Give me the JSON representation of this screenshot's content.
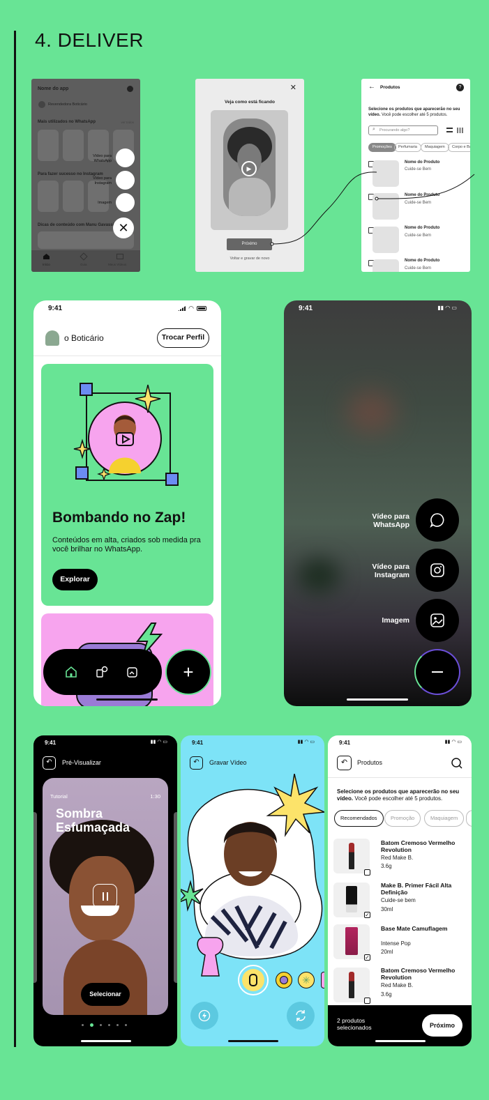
{
  "section": {
    "title": "4. DELIVER"
  },
  "wf1": {
    "title": "Nome do app",
    "reseller": "Revendedora Boticário",
    "most_used": "Mais utilizados no WhatsApp",
    "see_all": "ver todos",
    "success": "Para fazer sucesso no Instagram",
    "tips": "Dicas de conteúdo com Manu Gavassi",
    "fab_labels": [
      "Vídeo para WhatsApp",
      "Vídeo para Instagram",
      "Imagem"
    ],
    "nav": [
      "Início",
      "Guia",
      "Meus Vídeos"
    ]
  },
  "wf2": {
    "heading": "Veja como está ficando",
    "next": "Próximo",
    "redo": "Voltar e gravar de novo"
  },
  "wf3": {
    "title": "Produtos",
    "instruction_bold": "Selecione os produtos que aparecerão no seu vídeo.",
    "instruction_rest": " Você pode escolher até 5 produtos.",
    "search_placeholder": "Procurando algo?",
    "chips": [
      "Promoções",
      "Perfumaria",
      "Maquiagem",
      "Corpo e Ban"
    ],
    "products": [
      {
        "name": "Nome do Produto",
        "brand": "Cuide-se Bem"
      },
      {
        "name": "Nome do Produto",
        "brand": "Cuide-se Bem"
      },
      {
        "name": "Nome do Produto",
        "brand": "Cuide-se Bem"
      },
      {
        "name": "Nome do Produto",
        "brand": "Cuide-se Bem"
      }
    ]
  },
  "phone_home": {
    "time": "9:41",
    "brand": "o Boticário",
    "switch_profile": "Trocar Perfil",
    "card_title": "Bombando no Zap!",
    "card_text": "Conteúdos em alta, criados sob medida pra você brilhar no WhatsApp.",
    "explore": "Explorar"
  },
  "phone_menu": {
    "time": "9:41",
    "options": [
      "Vídeo para WhatsApp",
      "Vídeo para Instagram",
      "Imagem"
    ]
  },
  "phone_preview": {
    "time": "9:41",
    "title": "Pré-Visualizar",
    "tag": "Tutorial",
    "duration": "1:30",
    "video_title": "Sombra Esfumaçada",
    "select": "Selecionar"
  },
  "phone_record": {
    "time": "9:41",
    "title": "Gravar Vídeo"
  },
  "phone_products": {
    "time": "9:41",
    "title": "Produtos",
    "instruction_bold": "Selecione os produtos que aparecerão no seu vídeo.",
    "instruction_rest": " Você pode escolher até 5 produtos.",
    "chips": [
      "Recomendados",
      "Promoção",
      "Maquiagem"
    ],
    "products": [
      {
        "name": "Batom Cremoso Vermelho Revolution",
        "brand": "Red Make B.",
        "size": "3.6g",
        "checked": false
      },
      {
        "name": "Make B. Primer Fácil Alta Definição",
        "brand": "Cuide-se bem",
        "size": "30ml",
        "checked": true
      },
      {
        "name": "Base Mate Camuflagem",
        "brand": "Intense Pop",
        "size": "20ml",
        "checked": true
      },
      {
        "name": "Batom Cremoso Vermelho Revolution",
        "brand": "Red Make B.",
        "size": "3.6g",
        "checked": false
      }
    ],
    "selected_count": "2 produtos selecionados",
    "next": "Próximo"
  },
  "colors": {
    "background": "#68e495",
    "accent_blue": "#7de3f7",
    "pink": "#f7a4ee",
    "yellow": "#fce36a"
  }
}
